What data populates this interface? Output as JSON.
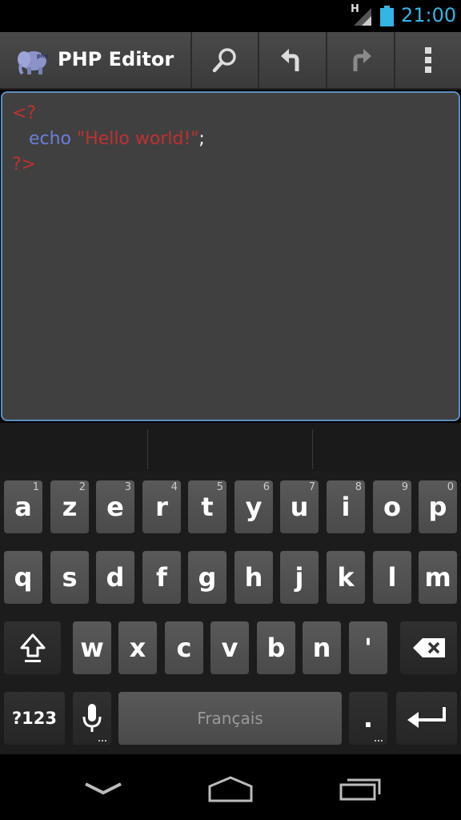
{
  "status_bar": {
    "network_type": "H",
    "time": "21:00",
    "accent": "#33b5e5"
  },
  "action_bar": {
    "title": "PHP Editor",
    "buttons": [
      "search-icon",
      "undo-icon",
      "redo-icon",
      "overflow-menu-icon"
    ]
  },
  "editor": {
    "lines": [
      {
        "tag": "<?"
      },
      {
        "indent": "   ",
        "keyword": "echo",
        "string": "\"Hello world!\"",
        "punct": ";"
      },
      {
        "tag": "?>"
      }
    ]
  },
  "keyboard": {
    "row1": [
      {
        "key": "a",
        "hint": "1"
      },
      {
        "key": "z",
        "hint": "2"
      },
      {
        "key": "e",
        "hint": "3"
      },
      {
        "key": "r",
        "hint": "4"
      },
      {
        "key": "t",
        "hint": "5"
      },
      {
        "key": "y",
        "hint": "6"
      },
      {
        "key": "u",
        "hint": "7"
      },
      {
        "key": "i",
        "hint": "8"
      },
      {
        "key": "o",
        "hint": "9"
      },
      {
        "key": "p",
        "hint": "0"
      }
    ],
    "row2": [
      "q",
      "s",
      "d",
      "f",
      "g",
      "h",
      "j",
      "k",
      "l",
      "m"
    ],
    "row3": [
      "w",
      "x",
      "c",
      "v",
      "b",
      "n",
      "'"
    ],
    "symbols_label": "?123",
    "space_label": "Français",
    "period_label": "."
  },
  "nav_bar": {
    "buttons": [
      "back-icon",
      "home-icon",
      "recents-icon"
    ]
  }
}
